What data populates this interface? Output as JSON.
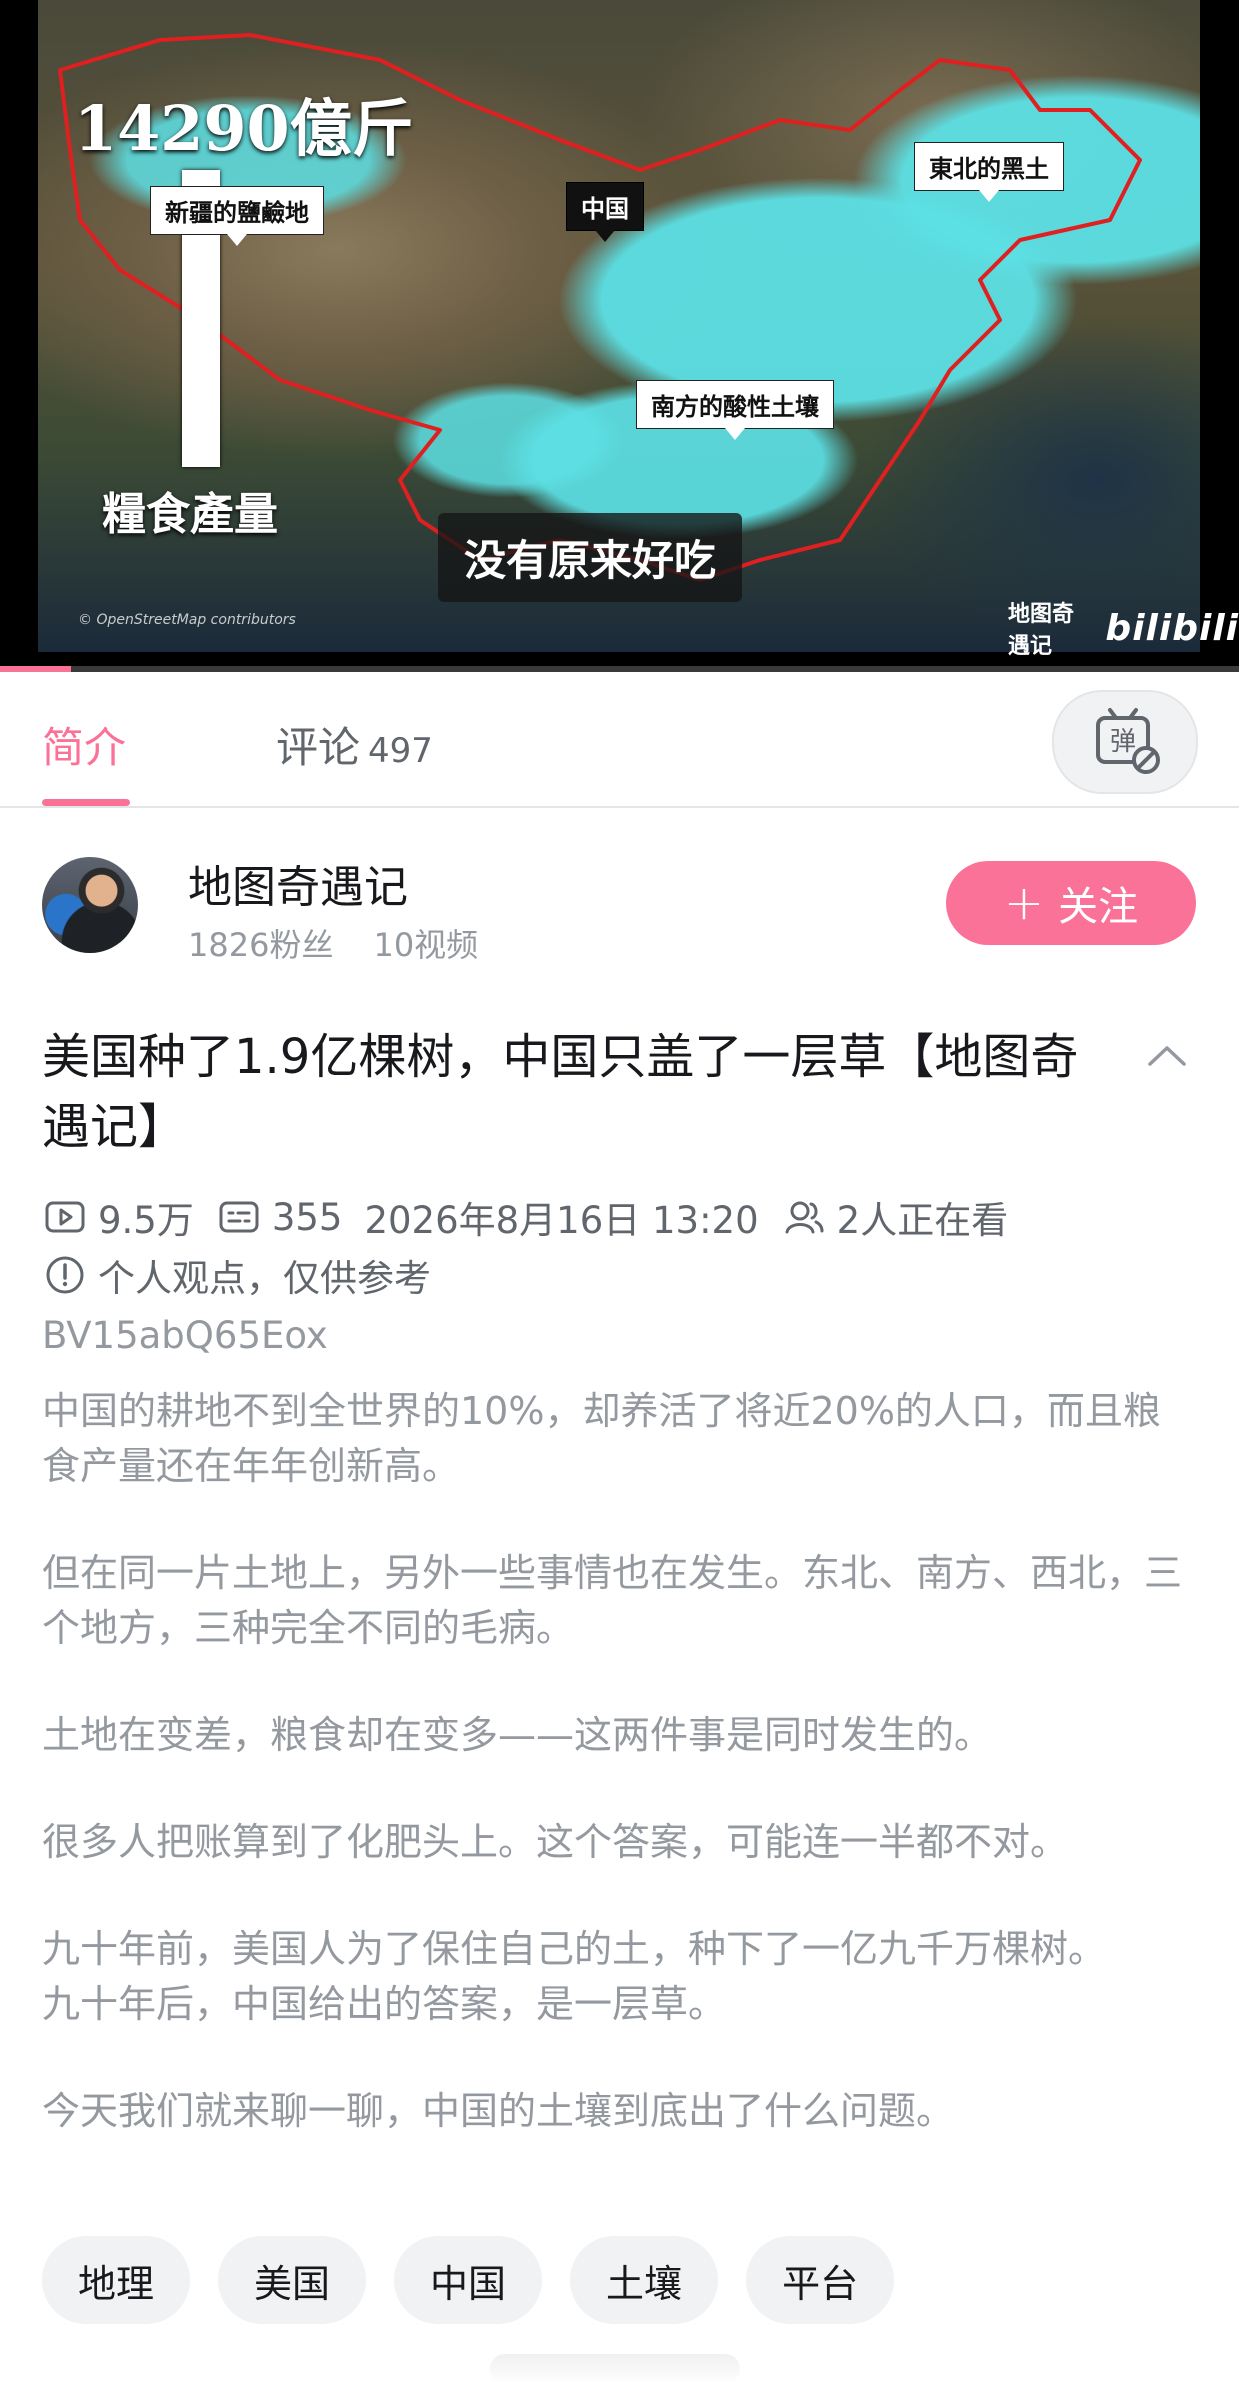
{
  "video": {
    "big_number": "14290億斤",
    "bar_label": "糧食產量",
    "map_tags": {
      "northwest": "新疆的鹽鹼地",
      "china": "中国",
      "northeast": "東北的黑土",
      "south": "南方的酸性土壤"
    },
    "subtitle": "没有原来好吃",
    "osm_credit": "© OpenStreetMap contributors",
    "watermark_channel": "地图奇遇记",
    "watermark_logo": "bilibili",
    "progress": 0.057
  },
  "tabs": {
    "intro_label": "简介",
    "comments_label": "评论",
    "comments_count": "497",
    "active": "intro"
  },
  "uploader": {
    "name": "地图奇遇记",
    "fans": "1826粉丝",
    "videos": "10视频",
    "follow_label": "关注",
    "follow_icon": "+"
  },
  "video_info": {
    "title": "美国种了1.9亿棵树，中国只盖了一层草【地图奇遇记】",
    "views": "9.5万",
    "danmaku": "355",
    "date": "2026年8月16日 13:20",
    "watching": "2人正在看",
    "notice": "个人观点，仅供参考",
    "bvid": "BV15abQ65Eox"
  },
  "description": [
    "中国的耕地不到全世界的10%，却养活了将近20%的人口，而且粮食产量还在年年创新高。",
    "但在同一片土地上，另外一些事情也在发生。东北、南方、西北，三个地方，三种完全不同的毛病。",
    "土地在变差，粮食却在变多——这两件事是同时发生的。",
    "很多人把账算到了化肥头上。这个答案，可能连一半都不对。",
    "九十年前，美国人为了保住自己的土，种下了一亿九千万棵树。\n九十年后，中国给出的答案，是一层草。",
    "今天我们就来聊一聊，中国的土壤到底出了什么问题。"
  ],
  "tags": [
    "地理",
    "美国",
    "中国",
    "土壤",
    "平台"
  ],
  "colors": {
    "accent": "#fb7299",
    "text_primary": "#18191c",
    "text_secondary": "#61666d",
    "text_muted": "#9499a0",
    "chip_bg": "#f1f2f3"
  }
}
